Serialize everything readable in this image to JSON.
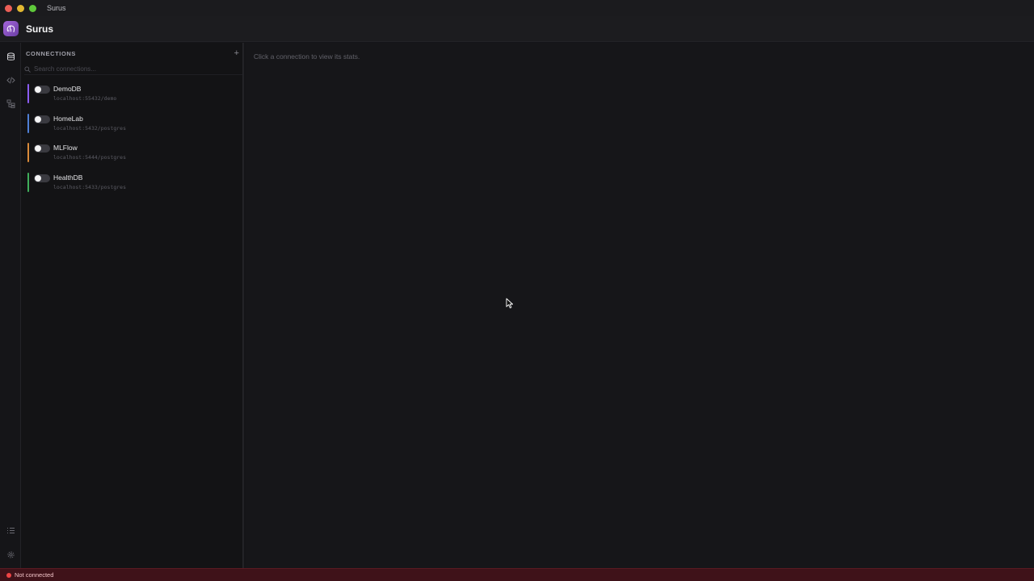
{
  "window": {
    "title": "Surus"
  },
  "app": {
    "name": "Surus",
    "brand_color": "#8b51c4"
  },
  "rail": {
    "top_icons": [
      "database-icon",
      "code-icon",
      "schema-icon"
    ],
    "bottom_icons": [
      "list-icon",
      "gear-icon"
    ]
  },
  "sidebar": {
    "title": "CONNECTIONS",
    "add_label": "+",
    "search_placeholder": "Search connections...",
    "connections": [
      {
        "name": "DemoDB",
        "host": "localhost:55432/demo",
        "color": "#8b5cf6",
        "enabled": false
      },
      {
        "name": "HomeLab",
        "host": "localhost:5432/postgres",
        "color": "#4f7fd6",
        "enabled": false
      },
      {
        "name": "MLFlow",
        "host": "localhost:5444/postgres",
        "color": "#d98a3a",
        "enabled": false
      },
      {
        "name": "HealthDB",
        "host": "localhost:5433/postgres",
        "color": "#3fae5b",
        "enabled": false
      }
    ]
  },
  "main": {
    "placeholder": "Click a connection to view its stats."
  },
  "status": {
    "text": "Not connected",
    "color": "#ef4444"
  }
}
